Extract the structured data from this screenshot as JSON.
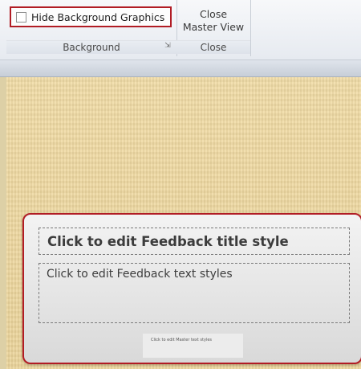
{
  "ribbon": {
    "hide_background_graphics_label": "Hide Background Graphics",
    "background_group_label": "Background",
    "close_master_view_line1": "Close",
    "close_master_view_line2": "Master View",
    "close_group_label": "Close",
    "dialog_launcher_symbol": "⇲"
  },
  "slide": {
    "feedback_title": "Click to edit Feedback title style",
    "feedback_text": "Click to edit Feedback text styles",
    "master_text": "Click to edit Master text styles"
  },
  "colors": {
    "highlight_red": "#b11c24",
    "ribbon_bg": "#eef1f5",
    "slide_texture": "#ecd49c",
    "panel_bg": "#e6e6e6"
  },
  "icons": {
    "checkbox": "unchecked-checkbox-icon",
    "launcher": "dialog-launcher-icon"
  }
}
